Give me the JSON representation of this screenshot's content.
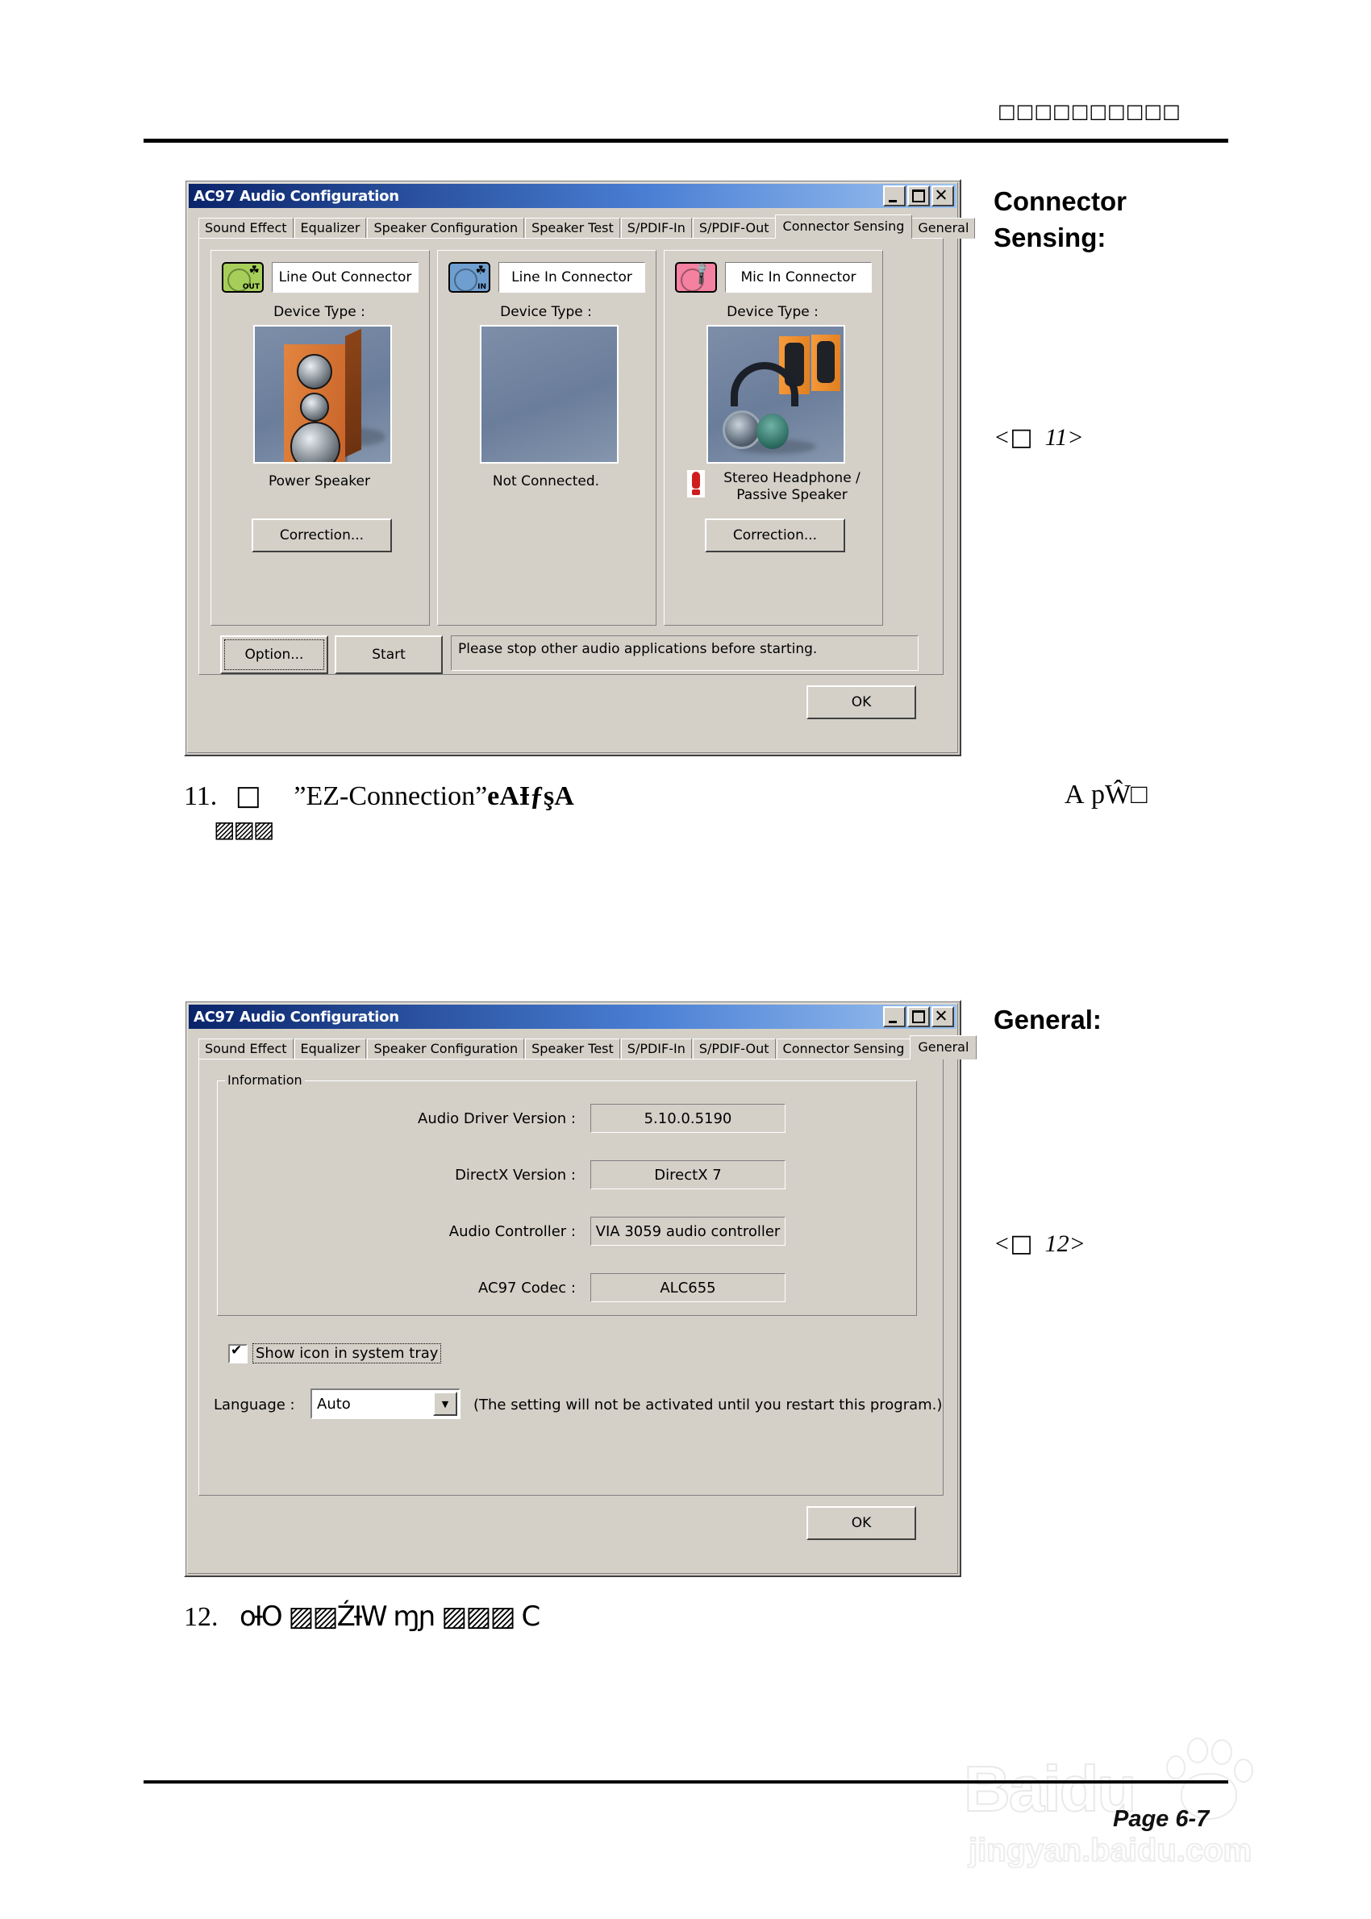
{
  "page": {
    "header_marks": "□□□□□□□□□□",
    "page_number": "Page 6-7",
    "watermark_text": "Baidu",
    "watermark_sub": "jingyan.baidu.com"
  },
  "margin": {
    "heading_1": "Connector\nSensing:",
    "heading_1_line1": "Connector",
    "heading_1_line2": "Sensing:",
    "heading_2": "General:",
    "figref_1_prefix": "<",
    "figref_1_box": "□",
    "figref_1_num": "11",
    "figref_1_suffix": ">",
    "figref_2_num": "12"
  },
  "body": {
    "item_11_number": "11.",
    "item_11_box": "□",
    "item_11_quoted": "”EZ-Connection”",
    "item_11_garble_a": "eАƗƒşА",
    "item_11_garble_right": "А pŴ□",
    "item_11_garble_second_line": "▨▨▨",
    "item_12_number": "12.",
    "item_12_garble": "oƗO ▨▨ŹƗW ɱɲ ▨▨▨ C"
  },
  "dialog1": {
    "title": "AC97 Audio Configuration",
    "window_buttons": [
      "minimize-button",
      "maximize-button",
      "close-button"
    ],
    "tabs": [
      {
        "label": "Sound Effect",
        "active": false
      },
      {
        "label": "Equalizer",
        "active": false
      },
      {
        "label": "Speaker Configuration",
        "active": false
      },
      {
        "label": "Speaker Test",
        "active": false
      },
      {
        "label": "S/PDIF-In",
        "active": false
      },
      {
        "label": "S/PDIF-Out",
        "active": false
      },
      {
        "label": "Connector Sensing",
        "active": true
      },
      {
        "label": "General",
        "active": false
      }
    ],
    "panels": [
      {
        "jack_color": "#a6cf5a",
        "jack_direction": "OUT",
        "jack_icon": "line-out-jack-icon",
        "connector_label": "Line Out Connector",
        "device_type_label": "Device Type :",
        "device_image": "powered-speaker-image",
        "status": "Power Speaker",
        "has_warning_icon": false,
        "correction_button": "Correction..."
      },
      {
        "jack_color": "#6f9fd0",
        "jack_direction": "IN",
        "jack_icon": "line-in-jack-icon",
        "connector_label": "Line In Connector",
        "device_type_label": "Device Type :",
        "device_image": "empty-blue-image",
        "status": "Not Connected.",
        "has_warning_icon": false,
        "correction_button": ""
      },
      {
        "jack_color": "#f4819f",
        "jack_direction": "",
        "jack_icon": "mic-in-jack-icon",
        "connector_label": "Mic In Connector",
        "device_type_label": "Device Type :",
        "device_image": "headphone-passive-speaker-image",
        "status": "Stereo Headphone /\nPassive Speaker",
        "status_line1": "Stereo Headphone /",
        "status_line2": "Passive Speaker",
        "has_warning_icon": true,
        "correction_button": "Correction..."
      }
    ],
    "option_button": "Option...",
    "start_button": "Start",
    "status_message": "Please stop other audio applications before starting.",
    "ok_button": "OK"
  },
  "dialog2": {
    "title": "AC97 Audio Configuration",
    "window_buttons": [
      "minimize-button",
      "maximize-button",
      "close-button"
    ],
    "tabs": [
      {
        "label": "Sound Effect",
        "active": false
      },
      {
        "label": "Equalizer",
        "active": false
      },
      {
        "label": "Speaker Configuration",
        "active": false
      },
      {
        "label": "Speaker Test",
        "active": false
      },
      {
        "label": "S/PDIF-In",
        "active": false
      },
      {
        "label": "S/PDIF-Out",
        "active": false
      },
      {
        "label": "Connector Sensing",
        "active": false
      },
      {
        "label": "General",
        "active": true
      }
    ],
    "group_legend": "Information",
    "fields": [
      {
        "label": "Audio Driver Version :",
        "value": "5.10.0.5190"
      },
      {
        "label": "DirectX Version :",
        "value": "DirectX 7"
      },
      {
        "label": "Audio Controller :",
        "value": "VIA 3059 audio controller"
      },
      {
        "label": "AC97 Codec :",
        "value": "ALC655"
      }
    ],
    "tray_checkbox_label": "Show icon in system tray",
    "tray_checkbox_checked": true,
    "language_label": "Language :",
    "language_value": "Auto",
    "language_note": "(The setting will not be activated until you restart this program.)",
    "ok_button": "OK"
  }
}
